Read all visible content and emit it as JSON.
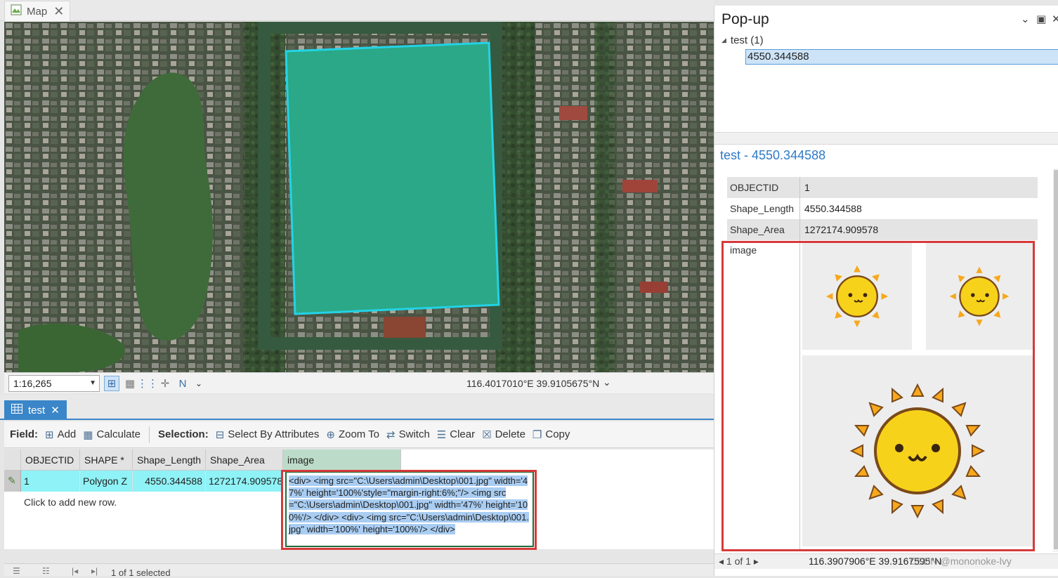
{
  "map_tab": {
    "title": "Map",
    "icon": "map-icon"
  },
  "map_status": {
    "scale": "1:16,265",
    "coordinates": "116.4017010°E 39.9105675°N"
  },
  "table_tab": {
    "title": "test",
    "icon": "table-icon"
  },
  "toolbar": {
    "field_label": "Field:",
    "add_label": "Add",
    "calculate_label": "Calculate",
    "selection_label": "Selection:",
    "select_by_attributes_label": "Select By Attributes",
    "zoom_to_label": "Zoom To",
    "switch_label": "Switch",
    "clear_label": "Clear",
    "delete_label": "Delete",
    "copy_label": "Copy"
  },
  "table": {
    "columns": [
      "OBJECTID *",
      "SHAPE *",
      "Shape_Length",
      "Shape_Area",
      "image"
    ],
    "row": {
      "objectid": "1",
      "shape": "Polygon Z",
      "shape_length": "4550.344588",
      "shape_area": "1272174.909578",
      "image_html": "<div> <img src=\"C:\\Users\\admin\\Desktop\\001.jpg\" width='47%' height='100%'style=\"margin-right:6%;\"/> <img src=\"C:\\Users\\admin\\Desktop\\001.jpg\" width='47%' height='100%'/> </div> <div> <img src=\"C:\\Users\\admin\\Desktop\\001.jpg\" width='100%' height='100%'/> </div>"
    },
    "new_row_hint": "Click to add new row.",
    "status_text": "1 of 1 selected"
  },
  "popup": {
    "title": "Pop-up",
    "layer_name": "test (1)",
    "feature_value": "4550.344588",
    "feature_title": "test - 4550.344588",
    "fields": [
      {
        "key": "OBJECTID",
        "value": "1"
      },
      {
        "key": "Shape_Length",
        "value": "4550.344588"
      },
      {
        "key": "Shape_Area",
        "value": "1272174.909578"
      }
    ],
    "image_label": "image",
    "nav_text": "1 of 1",
    "coordinates": "116.3907906°E 39.9167595°N",
    "watermark": "CSDN @mononoke-lvy"
  },
  "colors": {
    "polygon_fill": "#2ba887",
    "polygon_outline": "#22d3e6",
    "selected_row": "#8ff2f6",
    "accent": "#3a86c8",
    "highlight_box": "#d63a3a",
    "sun_yellow": "#f7d21b"
  }
}
